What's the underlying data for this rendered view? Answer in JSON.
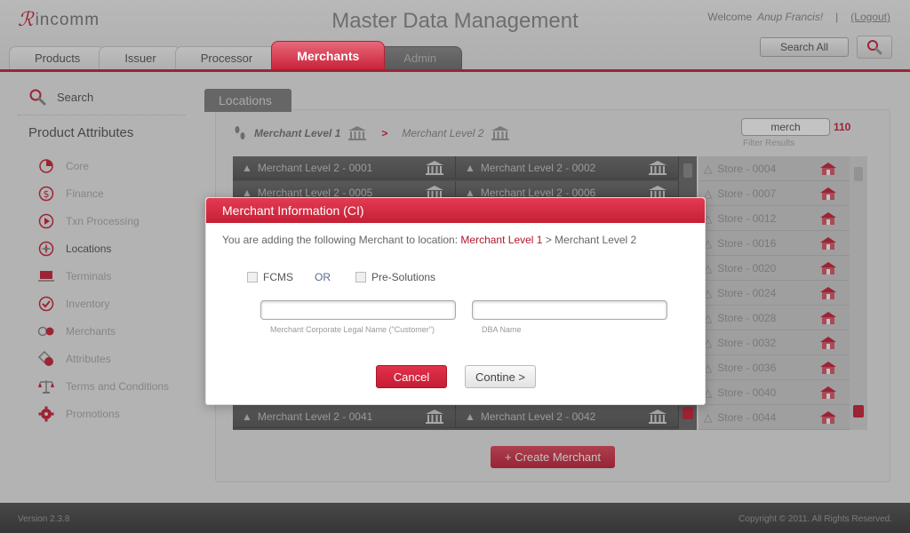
{
  "header": {
    "logo_text": "incomm",
    "title": "Master Data Management",
    "welcome_prefix": "Welcome",
    "user_name": "Anup Francis!",
    "separator": "|",
    "logout": "(Logout)",
    "search_all": "Search All"
  },
  "tabs": [
    {
      "label": "Products"
    },
    {
      "label": "Issuer"
    },
    {
      "label": "Processor"
    },
    {
      "label": "Merchants"
    },
    {
      "label": "Admin"
    }
  ],
  "sidebar": {
    "search_label": "Search",
    "heading": "Product Attributes",
    "items": [
      {
        "label": "Core",
        "icon": "pie-chart-icon"
      },
      {
        "label": "Finance",
        "icon": "dollar-icon"
      },
      {
        "label": "Txn Processing",
        "icon": "play-circle-icon"
      },
      {
        "label": "Locations",
        "icon": "compass-icon"
      },
      {
        "label": "Terminals",
        "icon": "laptop-icon"
      },
      {
        "label": "Inventory",
        "icon": "checkmark-icon"
      },
      {
        "label": "Merchants",
        "icon": "merchants-icon"
      },
      {
        "label": "Attributes",
        "icon": "shapes-icon"
      },
      {
        "label": "Terms and Conditions",
        "icon": "scales-icon"
      },
      {
        "label": "Promotions",
        "icon": "gear-icon"
      }
    ]
  },
  "content": {
    "section_tab": "Locations",
    "crumb_level1": "Merchant Level 1",
    "crumb_sep": ">",
    "crumb_level2": "Merchant Level 2",
    "filter_value": "merch",
    "filter_count": "110",
    "filter_label": "Filter Results",
    "merchant_rows": [
      [
        "Merchant Level 2 - 0001",
        "Merchant Level 2 - 0002"
      ],
      [
        "Merchant Level 2 - 0005",
        "Merchant Level 2 - 0006"
      ],
      [
        "Merchant Level 2 - 0041",
        "Merchant Level 2 - 0042"
      ]
    ],
    "stores": [
      "Store - 0004",
      "Store - 0007",
      "Store - 0012",
      "Store - 0016",
      "Store - 0020",
      "Store - 0024",
      "Store - 0028",
      "Store - 0032",
      "Store - 0036",
      "Store - 0040",
      "Store - 0044"
    ],
    "create_button": "+ Create Merchant"
  },
  "modal": {
    "title": "Merchant Information (CI)",
    "message_prefix": "You are adding the following Merchant to location:",
    "message_level1": "Merchant Level 1",
    "message_rest": "> Merchant Level 2",
    "fcms_label": "FCMS",
    "or_label": "OR",
    "presolutions_label": "Pre-Solutions",
    "legal_name_value": "",
    "legal_name_label": "Merchant Corporate Legal Name (\"Customer\")",
    "dba_value": "",
    "dba_label": "DBA Name",
    "cancel_label": "Cancel",
    "continue_label": "Contine >"
  },
  "footer": {
    "version": "Version 2.3.8",
    "copyright": "Copyright © 2011. All Rights Reserved."
  },
  "colors": {
    "accent": "#c9233a",
    "header_bg": "#e9e9e9",
    "footer_bg": "#444444"
  }
}
